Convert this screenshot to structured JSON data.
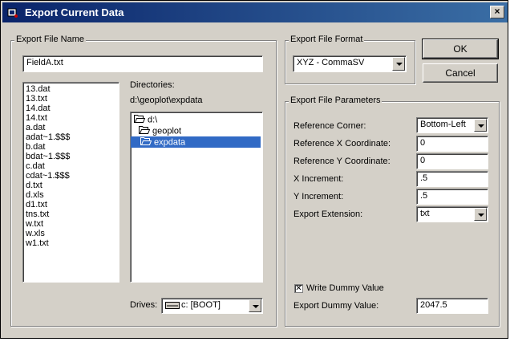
{
  "window": {
    "title": "Export Current Data",
    "close_label": "×"
  },
  "file_name_group": {
    "legend": "Export File Name",
    "file_name_value": "FieldA.txt",
    "files": [
      "13.dat",
      "13.txt",
      "14.dat",
      "14.txt",
      "a.dat",
      "adat~1.$$$",
      "b.dat",
      "bdat~1.$$$",
      "c.dat",
      "cdat~1.$$$",
      "d.txt",
      "d.xls",
      "d1.txt",
      "tns.txt",
      "w.txt",
      "w.xls",
      "w1.txt"
    ],
    "directories_label": "Directories:",
    "current_path": "d:\\geoplot\\expdata",
    "directories": [
      "d:\\",
      "geoplot",
      "expdata"
    ],
    "drives_label": "Drives:",
    "drive_value": "c: [BOOT]"
  },
  "format_group": {
    "legend": "Export File Format",
    "format_value": "XYZ - CommaSV"
  },
  "buttons": {
    "ok": "OK",
    "cancel": "Cancel"
  },
  "params_group": {
    "legend": "Export File Parameters",
    "reference_corner_label": "Reference Corner:",
    "reference_corner_value": "Bottom-Left",
    "ref_x_label": "Reference X Coordinate:",
    "ref_x_value": "0",
    "ref_y_label": "Reference Y Coordinate:",
    "ref_y_value": "0",
    "x_inc_label": "X Increment:",
    "x_inc_value": ".5",
    "y_inc_label": "Y Increment:",
    "y_inc_value": ".5",
    "ext_label": "Export Extension:",
    "ext_value": "txt",
    "write_dummy_label": "Write Dummy Value",
    "write_dummy_checked": true,
    "dummy_value_label": "Export Dummy Value:",
    "dummy_value": "2047.5"
  }
}
